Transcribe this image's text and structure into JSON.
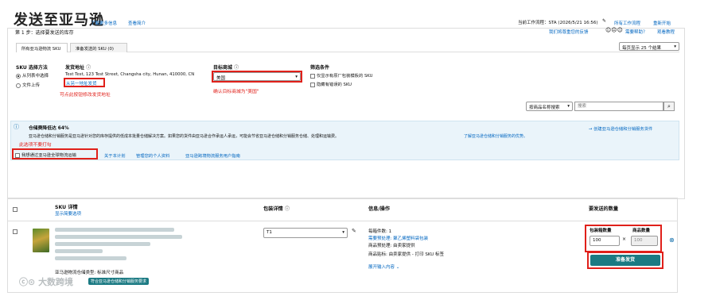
{
  "page": {
    "title": "发送至亚马逊",
    "learn_more": "了解更多信息",
    "view_video": "查看简介",
    "workflow": "当前工作流程：STA (2026/5/21 16:56)",
    "workflow_edit_icon": "pencil-icon",
    "other_workflows": "所有工作流程",
    "restart": "重新开始"
  },
  "step": {
    "label": "第 1 步：选择要发送的库存",
    "help_text": "我们将尊重您的反馈",
    "need_help": "需要帮助？",
    "view_tutorial": "观看教程"
  },
  "tabs": [
    {
      "label": "所有亚马逊物流 SKU"
    },
    {
      "label": "准备发送的 SKU (0)"
    }
  ],
  "page_size": {
    "value": "每页显示 25 个结果"
  },
  "sku_method": {
    "label": "SKU 选择方法",
    "options": [
      "从列表中选择",
      "文件上传"
    ],
    "selected": 0
  },
  "ship_from": {
    "label": "发货地址",
    "address": "Test Test, 123 Test Street, Changsha city, Hunan, 410000, CN",
    "change_link": "从另一地址发货",
    "note": "可点此按钮修改发货地址"
  },
  "marketplace": {
    "label": "目标商城",
    "value": "美国",
    "note": "确认目标商城为\"美国\""
  },
  "filter": {
    "label": "筛选条件",
    "options": [
      "仅显示有原厂包装模板的 SKU",
      "隐藏有错误的 SKU"
    ]
  },
  "search": {
    "scope": "按商品名称搜索",
    "placeholder": "搜索"
  },
  "info": {
    "title": "仓储费降低达 64%",
    "body": "亚马逊仓储和分销服务是亚马逊针对您的库存提供的低成本批量仓储解决方案。如果您的货件由亚马逊合作承运人承运，可能会节省亚马逊仓储和分销服务仓储、处理和运输费。",
    "learn_link": "了解亚马逊仓储和分销服务的优势。",
    "create_link": "创建亚马逊仓储和分销服务货件",
    "note": "此选项不要打勾",
    "optin": "我想通过亚马逊全球物流运输",
    "links": [
      "关于本计划",
      "管理您的个人资料",
      "亚马逊跨境物流服务用户指南"
    ]
  },
  "table": {
    "headers": {
      "sku": "SKU 详情",
      "sku_sub": "显示简要选项",
      "pack": "包装详情",
      "info": "信息/操作",
      "qty": "要发送的数量"
    },
    "row": {
      "pack_value": "T1",
      "info_lines": [
        "每箱件数: 1",
        "需要预处理: 聚乙烯塑料袋包装",
        "商品预处理: 由卖家提供",
        "商品贴标: 由卖家提供 - 打印 SKU 标签"
      ],
      "expand": "展开输入内容",
      "fba_type": "亚马逊物流仓储类型: 标准尺寸商品",
      "badge": "符合亚马逊仓储和分销服务要求",
      "boxes_label": "包装箱数量",
      "units_label": "商品数量",
      "boxes": "100",
      "units": "100",
      "ready": "准备发货",
      "watermark": "大数跨境"
    }
  }
}
